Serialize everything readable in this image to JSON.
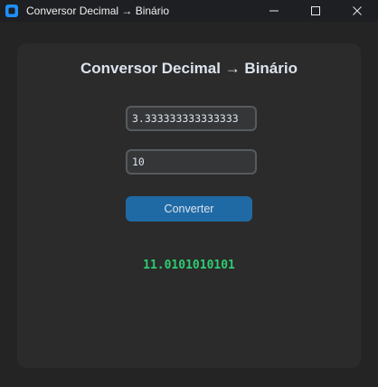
{
  "window": {
    "title": "Conversor Decimal → Binário"
  },
  "main": {
    "heading": "Conversor Decimal → Binário",
    "number_input": {
      "value": "3.333333333333333"
    },
    "base_input": {
      "value": "10"
    },
    "convert_label": "Converter",
    "result": "11.0101010101"
  },
  "colors": {
    "accent": "#1f6aa5",
    "result": "#2ecc71",
    "panel": "#2b2b2b",
    "background": "#242424"
  },
  "icons": [
    "app-icon",
    "minimize-icon",
    "maximize-icon",
    "close-icon"
  ]
}
